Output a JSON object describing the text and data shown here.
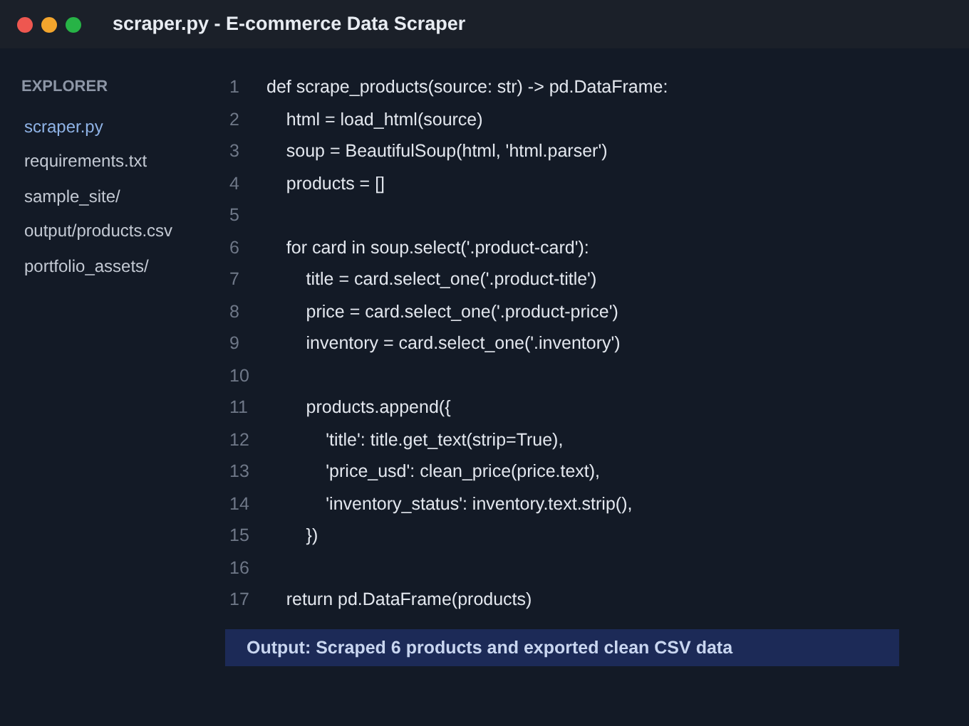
{
  "window": {
    "title": "scraper.py - E-commerce Data Scraper"
  },
  "sidebar": {
    "heading": "EXPLORER",
    "items": [
      {
        "label": "scraper.py",
        "selected": true
      },
      {
        "label": "requirements.txt",
        "selected": false
      },
      {
        "label": "sample_site/",
        "selected": false
      },
      {
        "label": "output/products.csv",
        "selected": false
      },
      {
        "label": "portfolio_assets/",
        "selected": false
      }
    ]
  },
  "editor": {
    "lines": [
      {
        "number": "1",
        "code": "def scrape_products(source: str) -> pd.DataFrame:"
      },
      {
        "number": "2",
        "code": "    html = load_html(source)"
      },
      {
        "number": "3",
        "code": "    soup = BeautifulSoup(html, 'html.parser')"
      },
      {
        "number": "4",
        "code": "    products = []"
      },
      {
        "number": "5"
      },
      {
        "number": "6",
        "code": "    for card in soup.select('.product-card'):"
      },
      {
        "number": "7",
        "code": "        title = card.select_one('.product-title')"
      },
      {
        "number": "8",
        "code": "        price = card.select_one('.product-price')"
      },
      {
        "number": "9",
        "code": "        inventory = card.select_one('.inventory')"
      },
      {
        "number": "10"
      },
      {
        "number": "11",
        "code": "        products.append({"
      },
      {
        "number": "12",
        "code": "            'title': title.get_text(strip=True),"
      },
      {
        "number": "13",
        "code": "            'price_usd': clean_price(price.text),"
      },
      {
        "number": "14",
        "code": "            'inventory_status': inventory.text.strip(),"
      },
      {
        "number": "15",
        "code": "        })"
      },
      {
        "number": "16"
      },
      {
        "number": "17",
        "code": "    return pd.DataFrame(products)"
      }
    ]
  },
  "output": "Output: Scraped 6 products and exported clean CSV data"
}
